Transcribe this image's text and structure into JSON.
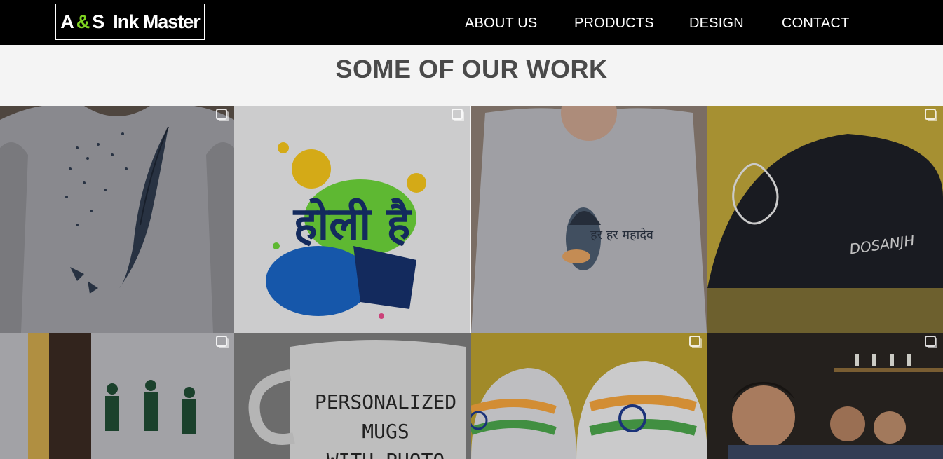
{
  "brand": {
    "logo_left": "A",
    "logo_amp": "&",
    "logo_right": "S  Ink Master",
    "accent_color": "#7ed321"
  },
  "nav": {
    "items": [
      {
        "label": "ABOUT US"
      },
      {
        "label": "PRODUCTS"
      },
      {
        "label": "DESIGN"
      },
      {
        "label": "CONTACT"
      }
    ]
  },
  "section": {
    "title": "SOME OF OUR WORK"
  },
  "gallery": {
    "tiles": [
      {
        "name": "feather-birds-tshirt",
        "icon": "multi-image-icon"
      },
      {
        "name": "holi-hai-tshirt",
        "text": "होली है",
        "icon": "multi-image-icon"
      },
      {
        "name": "shiva-har-har-mahadev-tshirt",
        "text": "हर हर महादेव"
      },
      {
        "name": "dosanjh-black-cap",
        "text": "DOSANJH",
        "icon": "multi-image-icon"
      },
      {
        "name": "dancing-figures-tshirt",
        "icon": "multi-image-icon"
      },
      {
        "name": "personalized-mug",
        "text_lines": [
          "PERSONALIZED",
          "MUGS",
          "WITH PHOTO"
        ]
      },
      {
        "name": "india-flag-caps",
        "icon": "multi-image-icon"
      },
      {
        "name": "team-selfie-photo",
        "icon": "multi-image-icon"
      }
    ]
  }
}
